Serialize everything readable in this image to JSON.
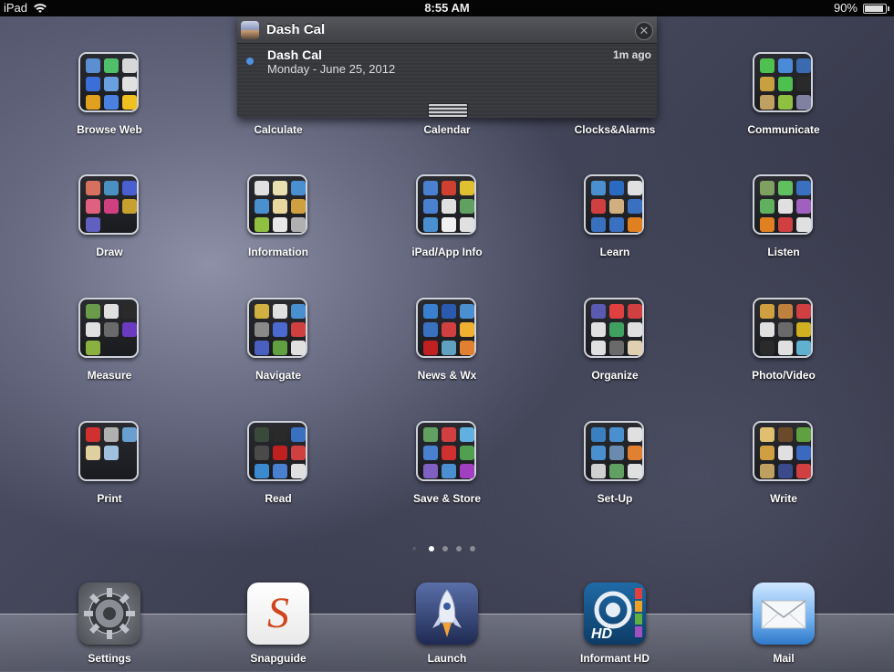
{
  "status_bar": {
    "carrier": "iPad",
    "time": "8:55 AM",
    "battery_text": "90%",
    "battery_level": 0.9
  },
  "notification": {
    "app_name": "Dash Cal",
    "title": "Dash Cal",
    "body": "Monday - June 25, 2012",
    "ago": "1m ago"
  },
  "folders": [
    {
      "label": "Browse Web",
      "icons": [
        "#5b8fd1",
        "#4fbf6a",
        "#d8d8d8",
        "#3a6fd8",
        "#6aa0e0",
        "#e0e0e0",
        "#e0a020",
        "#4a80e0",
        "#f0c020"
      ]
    },
    {
      "label": "Calculate",
      "icons": []
    },
    {
      "label": "Calendar",
      "icons": []
    },
    {
      "label": "Clocks&Alarms",
      "icons": []
    },
    {
      "label": "Communicate",
      "icons": [
        "#4fbf4f",
        "#4a8ad8",
        "#3a6ab0",
        "#c8a040",
        "#4fbf4f",
        "#2a2a2a",
        "#c0a060",
        "#90c040",
        "#8080a0"
      ]
    },
    {
      "label": "Draw",
      "icons": [
        "#d87060",
        "#4a90c0",
        "#4a60d0",
        "#e06080",
        "#d04080",
        "#c8a030",
        "#6060c0"
      ]
    },
    {
      "label": "Information",
      "icons": [
        "#e0e0e0",
        "#e8e0b0",
        "#4a90d0",
        "#4a90d0",
        "#e8d8a0",
        "#d0a040",
        "#90c040",
        "#e8e8e8",
        "#b0b0b0"
      ]
    },
    {
      "label": "iPad/App Info",
      "icons": [
        "#4a80d0",
        "#d04030",
        "#e0c030",
        "#4a80d0",
        "#e0e0e0",
        "#60a060",
        "#4a90d0",
        "#f0f0f0",
        "#e0e0e0"
      ]
    },
    {
      "label": "Learn",
      "icons": [
        "#4a90d0",
        "#2a6ac0",
        "#e0e0e0",
        "#d04040",
        "#d0b080",
        "#3a70c0",
        "#3a70c0",
        "#3a70c0",
        "#e08020"
      ]
    },
    {
      "label": "Listen",
      "icons": [
        "#80a060",
        "#60c060",
        "#3a70c0",
        "#60b060",
        "#e0e0e0",
        "#a060c0",
        "#e08020",
        "#d04040",
        "#e0e0e0"
      ]
    },
    {
      "label": "Measure",
      "icons": [
        "#6a9a4a",
        "#e0e0e0",
        "#2a2a2a",
        "#e0e0e0",
        "#6a6a6a",
        "#6a3ac0",
        "#8ab040"
      ]
    },
    {
      "label": "Navigate",
      "icons": [
        "#d0b040",
        "#e0e0e0",
        "#4a90d0",
        "#8a8a8a",
        "#4a6ad0",
        "#d04040",
        "#4a60c0",
        "#60a040",
        "#e0e0e0"
      ]
    },
    {
      "label": "News & Wx",
      "icons": [
        "#3a80d0",
        "#2a5ab0",
        "#4a90d0",
        "#3a70c0",
        "#d04040",
        "#f0b030",
        "#c02020",
        "#60a0c0",
        "#e08030"
      ]
    },
    {
      "label": "Organize",
      "icons": [
        "#5a5ab0",
        "#e04040",
        "#d04040",
        "#e0e0e0",
        "#40a060",
        "#e0e0e0",
        "#e0e0e0",
        "#6a6a6a",
        "#e0d0b0"
      ]
    },
    {
      "label": "Photo/Video",
      "icons": [
        "#d0a040",
        "#c08040",
        "#d04040",
        "#e0e0e0",
        "#6a6a6a",
        "#d0b020",
        "#2a2a2a",
        "#e0e0e0",
        "#60b0d0"
      ]
    },
    {
      "label": "Print",
      "icons": [
        "#d03030",
        "#b0b0b0",
        "#6aa0d0",
        "#e0d0a0",
        "#a0c0e0"
      ]
    },
    {
      "label": "Read",
      "icons": [
        "#3a4a3a",
        "#2a2a2a",
        "#3a70c0",
        "#4a4a4a",
        "#c02020",
        "#d04040",
        "#3a8ad0",
        "#4a80d0",
        "#e0e0e0"
      ]
    },
    {
      "label": "Save & Store",
      "icons": [
        "#60a060",
        "#d04040",
        "#60b0e0",
        "#4a80d0",
        "#d03030",
        "#50a050",
        "#8060c0",
        "#4a90d0",
        "#a040c0"
      ]
    },
    {
      "label": "Set-Up",
      "icons": [
        "#3a80c0",
        "#4a90d0",
        "#e0e0e0",
        "#4a90d0",
        "#6a8ab0",
        "#e08030",
        "#d0d0d0",
        "#60a060",
        "#e0e0e0"
      ]
    },
    {
      "label": "Write",
      "icons": [
        "#e0c070",
        "#6a4a2a",
        "#60a040",
        "#d0a040",
        "#e0e0e0",
        "#3a6ac0",
        "#c0a060",
        "#3a4a8a",
        "#d04040"
      ]
    }
  ],
  "page_indicator": {
    "pages": 4,
    "current": 1
  },
  "dock": [
    {
      "label": "Settings",
      "icon": "gear-icon"
    },
    {
      "label": "Snapguide",
      "icon": "snapguide-s-icon",
      "letter": "S"
    },
    {
      "label": "Launch",
      "icon": "rocket-icon"
    },
    {
      "label": "Informant HD",
      "icon": "informant-hd-icon",
      "letter": "HD"
    },
    {
      "label": "Mail",
      "icon": "envelope-icon"
    }
  ]
}
